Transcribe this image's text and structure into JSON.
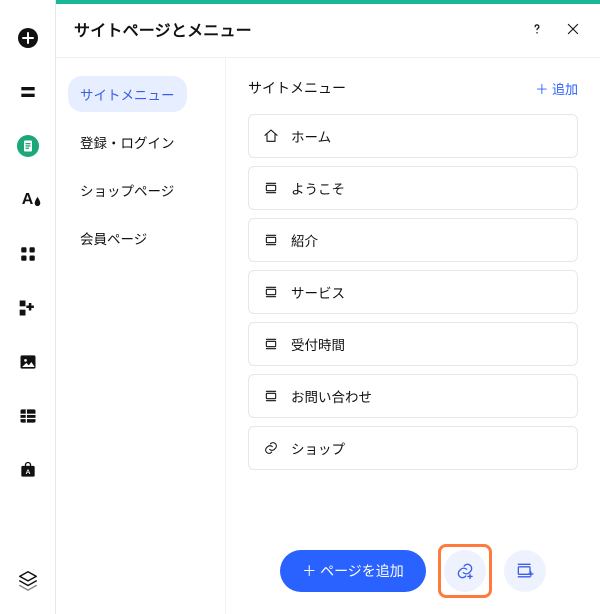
{
  "panel": {
    "title": "サイトページとメニュー"
  },
  "categories": [
    {
      "id": "site-menu",
      "label": "サイトメニュー",
      "active": true
    },
    {
      "id": "signup-login",
      "label": "登録・ログイン",
      "active": false
    },
    {
      "id": "shop-pages",
      "label": "ショップページ",
      "active": false
    },
    {
      "id": "member-pages",
      "label": "会員ページ",
      "active": false
    }
  ],
  "section": {
    "title": "サイトメニュー",
    "add_label": "＋ 追加"
  },
  "pages": [
    {
      "id": "home",
      "label": "ホーム",
      "icon": "home"
    },
    {
      "id": "welcome",
      "label": "ようこそ",
      "icon": "section"
    },
    {
      "id": "about",
      "label": "紹介",
      "icon": "section"
    },
    {
      "id": "services",
      "label": "サービス",
      "icon": "section"
    },
    {
      "id": "hours",
      "label": "受付時間",
      "icon": "section"
    },
    {
      "id": "contact",
      "label": "お問い合わせ",
      "icon": "section"
    },
    {
      "id": "shop",
      "label": "ショップ",
      "icon": "link"
    }
  ],
  "footer": {
    "add_page_label": "＋ ページを追加"
  },
  "rail_items": [
    {
      "id": "add",
      "name": "add-icon"
    },
    {
      "id": "section",
      "name": "section-icon"
    },
    {
      "id": "pages",
      "name": "pages-icon",
      "active": true
    },
    {
      "id": "theme",
      "name": "theme-icon"
    },
    {
      "id": "apps",
      "name": "apps-grid-icon"
    },
    {
      "id": "plugins",
      "name": "plugins-icon"
    },
    {
      "id": "media",
      "name": "media-icon"
    },
    {
      "id": "data",
      "name": "data-icon"
    },
    {
      "id": "store",
      "name": "store-icon"
    }
  ],
  "colors": {
    "accent": "#2a62ff",
    "active_bg": "#e6eeff",
    "rail_active": "#1aa876",
    "highlight": "#ff7a3d"
  }
}
